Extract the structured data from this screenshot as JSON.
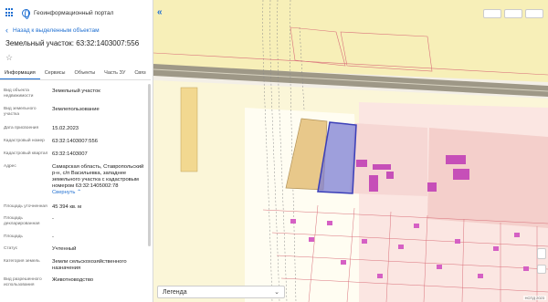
{
  "header": {
    "title": "Геоинформационный портал"
  },
  "nav": {
    "back_label": "Назад к выделенным объектам"
  },
  "object": {
    "title": "Земельный участок: 63:32:1403007:556"
  },
  "tabs": [
    {
      "label": "Информация"
    },
    {
      "label": "Сервисы"
    },
    {
      "label": "Объекты"
    },
    {
      "label": "Часть ЗУ"
    },
    {
      "label": "Связ"
    }
  ],
  "fields": [
    {
      "label": "Вид объекта недвижимости",
      "value": "Земельный участок"
    },
    {
      "label": "Вид земельного участка",
      "value": "Землепользование"
    },
    {
      "label": "Дата присвоения",
      "value": "15.02.2023"
    },
    {
      "label": "Кадастровый номер",
      "value": "63:32:1403007:556"
    },
    {
      "label": "Кадастровый квартал",
      "value": "63:32:1403007"
    },
    {
      "label": "Адрес",
      "value": "Самарская область, Ставропольский р-н, с/п Васильевка, западнее земельного участка с кадастровым номером 63:32:1405002:78",
      "link": "Свернуть"
    },
    {
      "label": "Площадь уточненная",
      "value": "45 394 кв. м"
    },
    {
      "label": "Площадь декларированная",
      "value": "-"
    },
    {
      "label": "Площадь",
      "value": "-"
    },
    {
      "label": "Статус",
      "value": "Учтенный"
    },
    {
      "label": "Категория земель",
      "value": "Земли сельскохозяйственного назначения"
    },
    {
      "label": "Вид разрешенного использования",
      "value": "Животноводство"
    }
  ],
  "map": {
    "legend_label": "Легенда",
    "attribution": "НСПД 2023",
    "colors": {
      "selected": "#3b3fb8",
      "selected_fill": "#7e7fd4",
      "building": "#c64fb8",
      "parcel_line": "#d9707a",
      "road": "#a79f8a"
    }
  }
}
